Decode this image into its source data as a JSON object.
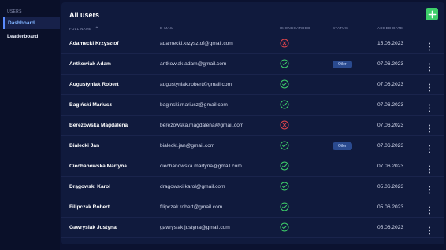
{
  "sidebar": {
    "section": "USERS",
    "items": [
      {
        "label": "Dashboard",
        "active": true
      },
      {
        "label": "Leaderboard",
        "active": false
      }
    ]
  },
  "main": {
    "title": "All users",
    "add_icon": "plus-icon",
    "columns": {
      "full_name": "FULL NAME",
      "email": "E-MAIL",
      "onboarded": "IS ONBOARDED",
      "status": "STATUS",
      "added": "ADDED DATE"
    },
    "sort_icon": "chevron-up-icon",
    "rows": [
      {
        "name": "Adamecki Krzysztof",
        "email": "adamecki.krzysztof@gmail.com",
        "onboarded": false,
        "status": "",
        "date": "15.06.2023"
      },
      {
        "name": "Antkowiak Adam",
        "email": "antkowiak.adam@gmail.com",
        "onboarded": true,
        "status": "Oiler",
        "date": "07.06.2023"
      },
      {
        "name": "Augustyniak Robert",
        "email": "augustyniak.robert@gmail.com",
        "onboarded": true,
        "status": "",
        "date": "07.06.2023"
      },
      {
        "name": "Bagiński Mariusz",
        "email": "baginski.mariusz@gmail.com",
        "onboarded": true,
        "status": "",
        "date": "07.06.2023"
      },
      {
        "name": "Berezowska Magdalena",
        "email": "berezowska.magdalena@gmail.com",
        "onboarded": false,
        "status": "",
        "date": "07.06.2023"
      },
      {
        "name": "Białecki Jan",
        "email": "bialecki.jan@gmail.com",
        "onboarded": true,
        "status": "Oiler",
        "date": "07.06.2023"
      },
      {
        "name": "Ciechanowska Martyna",
        "email": "ciechanowska.martyna@gmail.com",
        "onboarded": true,
        "status": "",
        "date": "07.06.2023"
      },
      {
        "name": "Drągowski Karol",
        "email": "dragowski.karol@gmail.com",
        "onboarded": true,
        "status": "",
        "date": "05.06.2023"
      },
      {
        "name": "Filipczak Robert",
        "email": "filipczak.robert@gmail.com",
        "onboarded": true,
        "status": "",
        "date": "05.06.2023"
      },
      {
        "name": "Gawrysiak Justyna",
        "email": "gawrysiak.justyna@gmail.com",
        "onboarded": true,
        "status": "",
        "date": "05.06.2023"
      }
    ],
    "row_menu_icon": "more-vertical-icon",
    "colors": {
      "check": "#3ecf6a",
      "cross": "#e0454b",
      "badge": "#2a4a8f",
      "add": "#3ecf6a"
    }
  }
}
